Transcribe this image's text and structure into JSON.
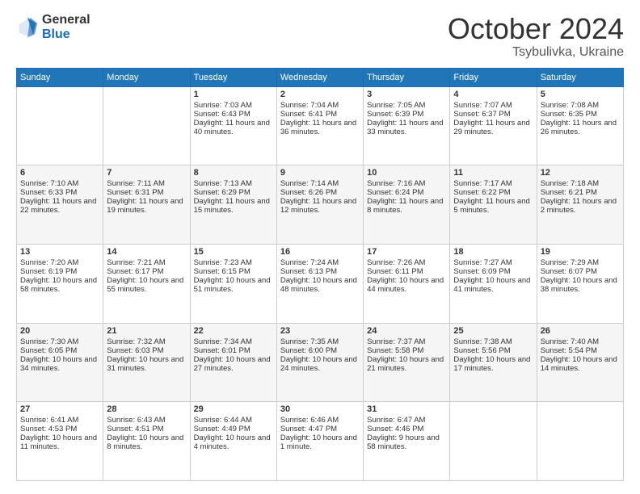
{
  "logo": {
    "general": "General",
    "blue": "Blue"
  },
  "title": "October 2024",
  "subtitle": "Tsybulivka, Ukraine",
  "days": [
    "Sunday",
    "Monday",
    "Tuesday",
    "Wednesday",
    "Thursday",
    "Friday",
    "Saturday"
  ],
  "weeks": [
    [
      {
        "day": "",
        "sunrise": "",
        "sunset": "",
        "daylight": ""
      },
      {
        "day": "",
        "sunrise": "",
        "sunset": "",
        "daylight": ""
      },
      {
        "day": "1",
        "sunrise": "Sunrise: 7:03 AM",
        "sunset": "Sunset: 6:43 PM",
        "daylight": "Daylight: 11 hours and 40 minutes."
      },
      {
        "day": "2",
        "sunrise": "Sunrise: 7:04 AM",
        "sunset": "Sunset: 6:41 PM",
        "daylight": "Daylight: 11 hours and 36 minutes."
      },
      {
        "day": "3",
        "sunrise": "Sunrise: 7:05 AM",
        "sunset": "Sunset: 6:39 PM",
        "daylight": "Daylight: 11 hours and 33 minutes."
      },
      {
        "day": "4",
        "sunrise": "Sunrise: 7:07 AM",
        "sunset": "Sunset: 6:37 PM",
        "daylight": "Daylight: 11 hours and 29 minutes."
      },
      {
        "day": "5",
        "sunrise": "Sunrise: 7:08 AM",
        "sunset": "Sunset: 6:35 PM",
        "daylight": "Daylight: 11 hours and 26 minutes."
      }
    ],
    [
      {
        "day": "6",
        "sunrise": "Sunrise: 7:10 AM",
        "sunset": "Sunset: 6:33 PM",
        "daylight": "Daylight: 11 hours and 22 minutes."
      },
      {
        "day": "7",
        "sunrise": "Sunrise: 7:11 AM",
        "sunset": "Sunset: 6:31 PM",
        "daylight": "Daylight: 11 hours and 19 minutes."
      },
      {
        "day": "8",
        "sunrise": "Sunrise: 7:13 AM",
        "sunset": "Sunset: 6:29 PM",
        "daylight": "Daylight: 11 hours and 15 minutes."
      },
      {
        "day": "9",
        "sunrise": "Sunrise: 7:14 AM",
        "sunset": "Sunset: 6:26 PM",
        "daylight": "Daylight: 11 hours and 12 minutes."
      },
      {
        "day": "10",
        "sunrise": "Sunrise: 7:16 AM",
        "sunset": "Sunset: 6:24 PM",
        "daylight": "Daylight: 11 hours and 8 minutes."
      },
      {
        "day": "11",
        "sunrise": "Sunrise: 7:17 AM",
        "sunset": "Sunset: 6:22 PM",
        "daylight": "Daylight: 11 hours and 5 minutes."
      },
      {
        "day": "12",
        "sunrise": "Sunrise: 7:18 AM",
        "sunset": "Sunset: 6:21 PM",
        "daylight": "Daylight: 11 hours and 2 minutes."
      }
    ],
    [
      {
        "day": "13",
        "sunrise": "Sunrise: 7:20 AM",
        "sunset": "Sunset: 6:19 PM",
        "daylight": "Daylight: 10 hours and 58 minutes."
      },
      {
        "day": "14",
        "sunrise": "Sunrise: 7:21 AM",
        "sunset": "Sunset: 6:17 PM",
        "daylight": "Daylight: 10 hours and 55 minutes."
      },
      {
        "day": "15",
        "sunrise": "Sunrise: 7:23 AM",
        "sunset": "Sunset: 6:15 PM",
        "daylight": "Daylight: 10 hours and 51 minutes."
      },
      {
        "day": "16",
        "sunrise": "Sunrise: 7:24 AM",
        "sunset": "Sunset: 6:13 PM",
        "daylight": "Daylight: 10 hours and 48 minutes."
      },
      {
        "day": "17",
        "sunrise": "Sunrise: 7:26 AM",
        "sunset": "Sunset: 6:11 PM",
        "daylight": "Daylight: 10 hours and 44 minutes."
      },
      {
        "day": "18",
        "sunrise": "Sunrise: 7:27 AM",
        "sunset": "Sunset: 6:09 PM",
        "daylight": "Daylight: 10 hours and 41 minutes."
      },
      {
        "day": "19",
        "sunrise": "Sunrise: 7:29 AM",
        "sunset": "Sunset: 6:07 PM",
        "daylight": "Daylight: 10 hours and 38 minutes."
      }
    ],
    [
      {
        "day": "20",
        "sunrise": "Sunrise: 7:30 AM",
        "sunset": "Sunset: 6:05 PM",
        "daylight": "Daylight: 10 hours and 34 minutes."
      },
      {
        "day": "21",
        "sunrise": "Sunrise: 7:32 AM",
        "sunset": "Sunset: 6:03 PM",
        "daylight": "Daylight: 10 hours and 31 minutes."
      },
      {
        "day": "22",
        "sunrise": "Sunrise: 7:34 AM",
        "sunset": "Sunset: 6:01 PM",
        "daylight": "Daylight: 10 hours and 27 minutes."
      },
      {
        "day": "23",
        "sunrise": "Sunrise: 7:35 AM",
        "sunset": "Sunset: 6:00 PM",
        "daylight": "Daylight: 10 hours and 24 minutes."
      },
      {
        "day": "24",
        "sunrise": "Sunrise: 7:37 AM",
        "sunset": "Sunset: 5:58 PM",
        "daylight": "Daylight: 10 hours and 21 minutes."
      },
      {
        "day": "25",
        "sunrise": "Sunrise: 7:38 AM",
        "sunset": "Sunset: 5:56 PM",
        "daylight": "Daylight: 10 hours and 17 minutes."
      },
      {
        "day": "26",
        "sunrise": "Sunrise: 7:40 AM",
        "sunset": "Sunset: 5:54 PM",
        "daylight": "Daylight: 10 hours and 14 minutes."
      }
    ],
    [
      {
        "day": "27",
        "sunrise": "Sunrise: 6:41 AM",
        "sunset": "Sunset: 4:53 PM",
        "daylight": "Daylight: 10 hours and 11 minutes."
      },
      {
        "day": "28",
        "sunrise": "Sunrise: 6:43 AM",
        "sunset": "Sunset: 4:51 PM",
        "daylight": "Daylight: 10 hours and 8 minutes."
      },
      {
        "day": "29",
        "sunrise": "Sunrise: 6:44 AM",
        "sunset": "Sunset: 4:49 PM",
        "daylight": "Daylight: 10 hours and 4 minutes."
      },
      {
        "day": "30",
        "sunrise": "Sunrise: 6:46 AM",
        "sunset": "Sunset: 4:47 PM",
        "daylight": "Daylight: 10 hours and 1 minute."
      },
      {
        "day": "31",
        "sunrise": "Sunrise: 6:47 AM",
        "sunset": "Sunset: 4:46 PM",
        "daylight": "Daylight: 9 hours and 58 minutes."
      },
      {
        "day": "",
        "sunrise": "",
        "sunset": "",
        "daylight": ""
      },
      {
        "day": "",
        "sunrise": "",
        "sunset": "",
        "daylight": ""
      }
    ]
  ]
}
